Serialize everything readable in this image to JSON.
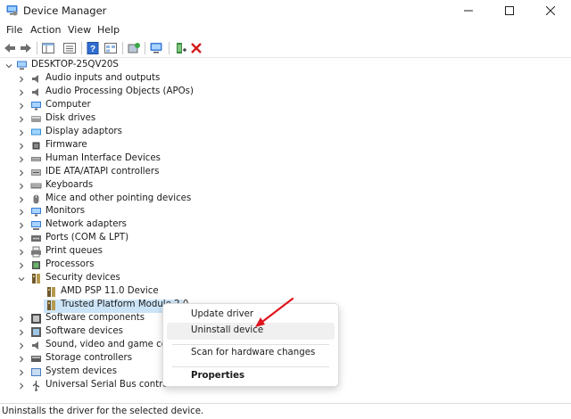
{
  "window": {
    "title": "Device Manager",
    "icons": {
      "app": "device-manager-icon",
      "minimize": "minimize-icon",
      "maximize": "maximize-icon",
      "close": "close-icon"
    }
  },
  "menu": [
    "File",
    "Action",
    "View",
    "Help"
  ],
  "toolbar": {
    "buttons": [
      "back-arrow-icon",
      "forward-arrow-icon",
      "show-hide-console-tree-icon",
      "properties-icon",
      "help-icon",
      "view-icon",
      "update-driver-icon",
      "scan-hardware-icon",
      "add-device-icon",
      "uninstall-icon"
    ],
    "accent_uninstall": "#d31c1c"
  },
  "tree": {
    "root": {
      "label": "DESKTOP-25QV20S",
      "icon": "computer-icon"
    },
    "categories": [
      {
        "label": "Audio inputs and outputs",
        "icon": "speaker-icon"
      },
      {
        "label": "Audio Processing Objects (APOs)",
        "icon": "speaker-icon"
      },
      {
        "label": "Computer",
        "icon": "monitor-icon"
      },
      {
        "label": "Disk drives",
        "icon": "disk-drive-icon"
      },
      {
        "label": "Display adaptors",
        "icon": "display-adapter-icon"
      },
      {
        "label": "Firmware",
        "icon": "chip-icon"
      },
      {
        "label": "Human Interface Devices",
        "icon": "hid-icon"
      },
      {
        "label": "IDE ATA/ATAPI controllers",
        "icon": "controller-icon"
      },
      {
        "label": "Keyboards",
        "icon": "keyboard-icon"
      },
      {
        "label": "Mice and other pointing devices",
        "icon": "mouse-icon"
      },
      {
        "label": "Monitors",
        "icon": "monitor-icon"
      },
      {
        "label": "Network adapters",
        "icon": "network-icon"
      },
      {
        "label": "Ports (COM & LPT)",
        "icon": "port-icon"
      },
      {
        "label": "Print queues",
        "icon": "printer-icon"
      },
      {
        "label": "Processors",
        "icon": "processor-icon"
      },
      {
        "label": "Security devices",
        "icon": "security-key-icon",
        "expanded": true,
        "children": [
          {
            "label": "AMD PSP 11.0 Device",
            "icon": "security-key-icon"
          },
          {
            "label": "Trusted Platform Module 2.0",
            "icon": "security-key-icon",
            "selected": true
          }
        ]
      },
      {
        "label": "Software components",
        "icon": "software-component-icon"
      },
      {
        "label": "Software devices",
        "icon": "software-device-icon"
      },
      {
        "label": "Sound, video and game controllers",
        "icon": "speaker-icon"
      },
      {
        "label": "Storage controllers",
        "icon": "storage-controller-icon"
      },
      {
        "label": "System devices",
        "icon": "system-device-icon"
      },
      {
        "label": "Universal Serial Bus controllers",
        "icon": "usb-icon"
      }
    ]
  },
  "context_menu": {
    "items": [
      "Update driver",
      "Uninstall device",
      "Scan for hardware changes",
      "Properties"
    ],
    "hovered": "Uninstall device",
    "annotation_color": "#e0141e"
  },
  "status": "Uninstalls the driver for the selected device."
}
